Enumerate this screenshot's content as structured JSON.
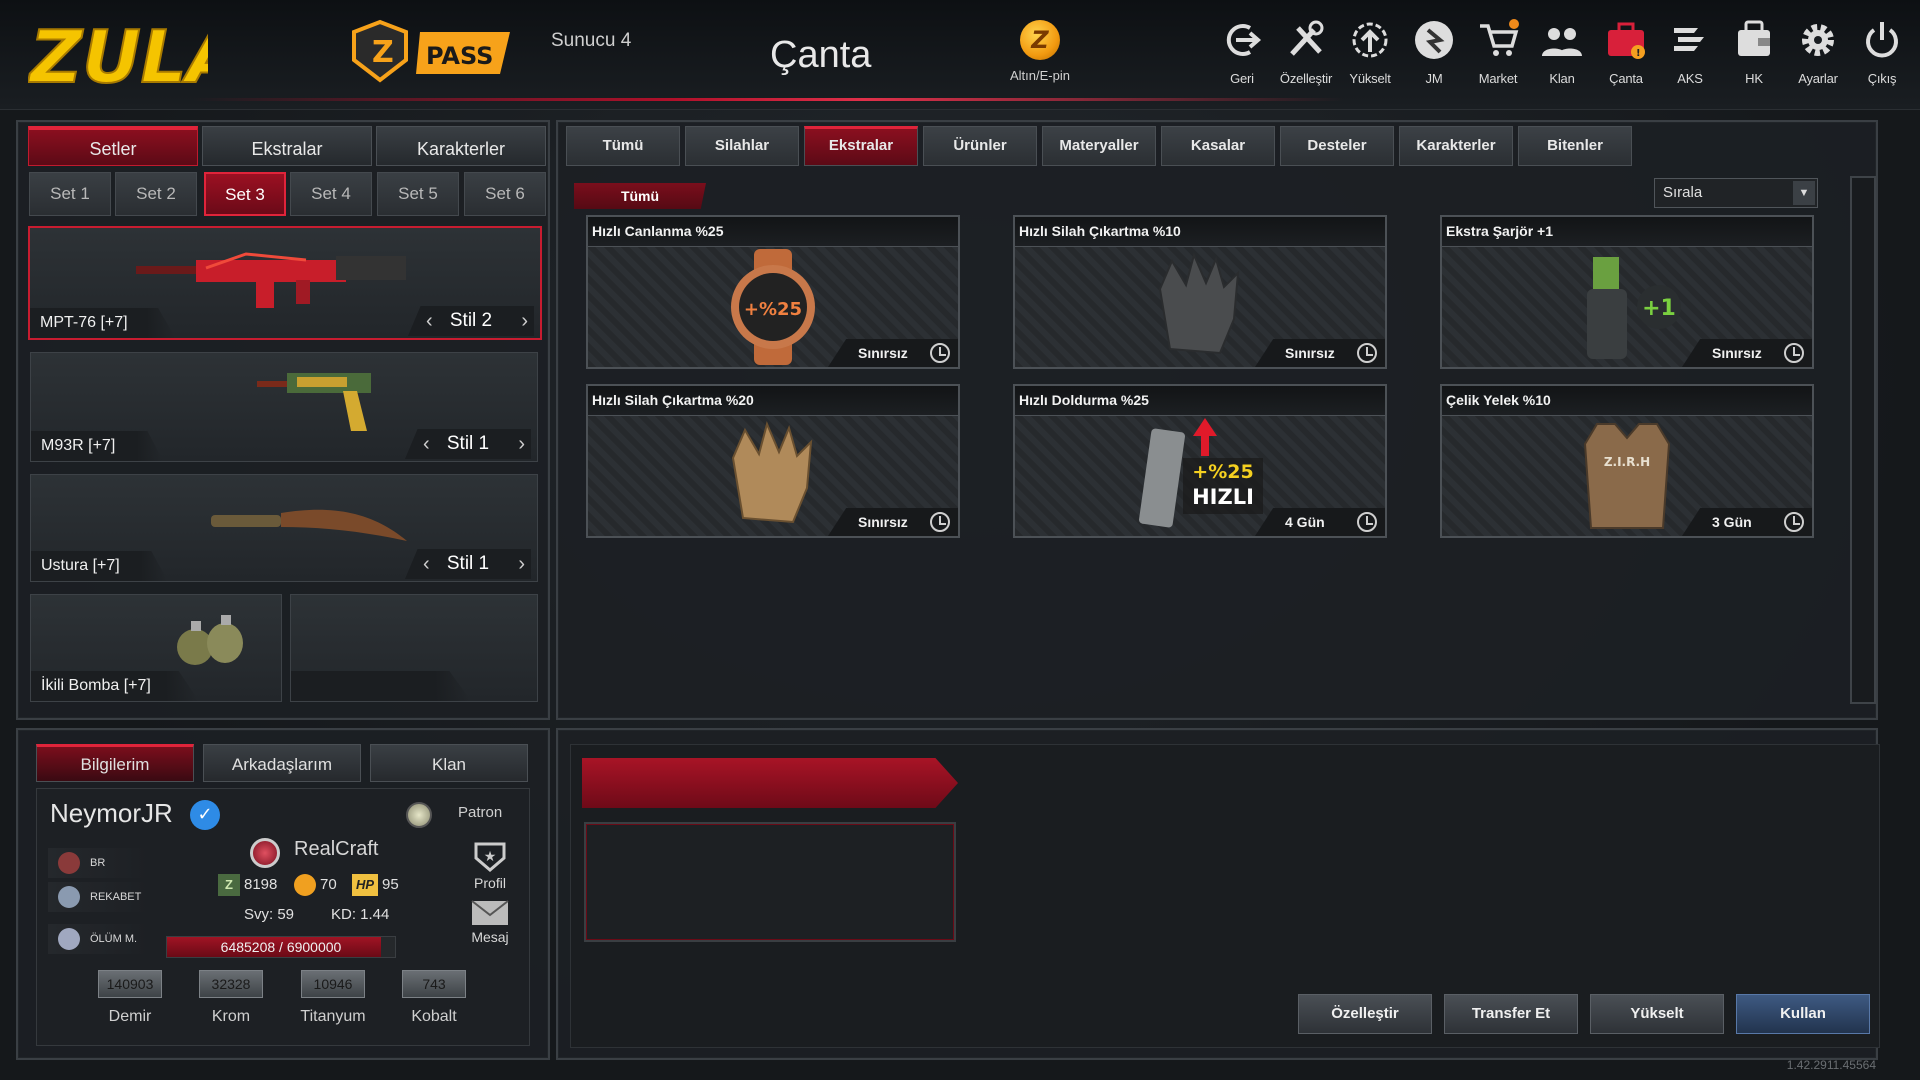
{
  "header": {
    "logo_text": "ZULA",
    "pass_text": "PASS",
    "server": "Sunucu 4",
    "title": "Çanta",
    "coin_label": "Altın/E-pin",
    "nav": [
      {
        "label": "Geri",
        "icon": "back-icon"
      },
      {
        "label": "Özelleştir",
        "icon": "tools-icon"
      },
      {
        "label": "Yükselt",
        "icon": "upgrade-icon"
      },
      {
        "label": "JM",
        "icon": "jm-icon"
      },
      {
        "label": "Market",
        "icon": "cart-icon"
      },
      {
        "label": "Klan",
        "icon": "clan-icon"
      },
      {
        "label": "Çanta",
        "icon": "bag-icon"
      },
      {
        "label": "AKS",
        "icon": "aks-icon"
      },
      {
        "label": "HK",
        "icon": "wallet-icon"
      },
      {
        "label": "Ayarlar",
        "icon": "gear-icon"
      },
      {
        "label": "Çıkış",
        "icon": "power-icon"
      }
    ]
  },
  "left": {
    "tabs": [
      "Setler",
      "Ekstralar",
      "Karakterler"
    ],
    "active_tab": "Setler",
    "sets": [
      "Set 1",
      "Set 2",
      "Set 3",
      "Set 4",
      "Set 5",
      "Set 6"
    ],
    "active_set": "Set 3",
    "weapons": [
      {
        "name": "MPT-76 [+7]",
        "style": "Stil 2"
      },
      {
        "name": "M93R [+7]",
        "style": "Stil 1"
      },
      {
        "name": "Ustura [+7]",
        "style": "Stil 1"
      },
      {
        "name": "İkili Bomba [+7]"
      }
    ]
  },
  "items": {
    "categories": [
      "Tümü",
      "Silahlar",
      "Ekstralar",
      "Ürünler",
      "Materyaller",
      "Kasalar",
      "Desteler",
      "Karakterler",
      "Bitenler"
    ],
    "active_category": "Ekstralar",
    "subtab": "Tümü",
    "sort_label": "Sırala",
    "cards": [
      {
        "title": "Hızlı Canlanma %25",
        "duration": "Sınırsız",
        "icon": "watch-icon",
        "overlay": "+%25"
      },
      {
        "title": "Hızlı Silah Çıkartma %10",
        "duration": "Sınırsız",
        "icon": "glove-icon"
      },
      {
        "title": "Ekstra Şarjör +1",
        "duration": "Sınırsız",
        "icon": "magazine-pouch-icon",
        "overlay": "+1"
      },
      {
        "title": "Hızlı Silah Çıkartma %20",
        "duration": "Sınırsız",
        "icon": "glove-icon"
      },
      {
        "title": "Hızlı Doldurma %25",
        "duration": "4 Gün",
        "icon": "magazine-icon",
        "overlay": "+%25",
        "overlay2": "HIZLI"
      },
      {
        "title": "Çelik Yelek %10",
        "duration": "3 Gün",
        "icon": "vest-icon",
        "overlay": "Z.I.R.H"
      }
    ]
  },
  "info": {
    "tabs": [
      "Bilgilerim",
      "Arkadaşlarım",
      "Klan"
    ],
    "active_tab": "Bilgilerim",
    "username": "NeymorJR",
    "rank": "Patron",
    "badges": [
      "BR",
      "REKABET",
      "ÖLÜM M."
    ],
    "clan": "RealCraft",
    "currency": {
      "z": "8198",
      "gold": "70",
      "hp": "95",
      "z_mark": "Z",
      "hp_mark": "HP"
    },
    "level": "Svy: 59",
    "kd": "KD: 1.44",
    "xp_text": "6485208 / 6900000",
    "xp_current": 6485208,
    "xp_max": 6900000,
    "profile_label": "Profil",
    "message_label": "Mesaj",
    "resources": [
      {
        "value": "140903",
        "label": "Demir"
      },
      {
        "value": "32328",
        "label": "Krom"
      },
      {
        "value": "10946",
        "label": "Titanyum"
      },
      {
        "value": "743",
        "label": "Kobalt"
      }
    ]
  },
  "actions": [
    "Özelleştir",
    "Transfer Et",
    "Yükselt",
    "Kullan"
  ],
  "version": "1.42.2911.45564"
}
